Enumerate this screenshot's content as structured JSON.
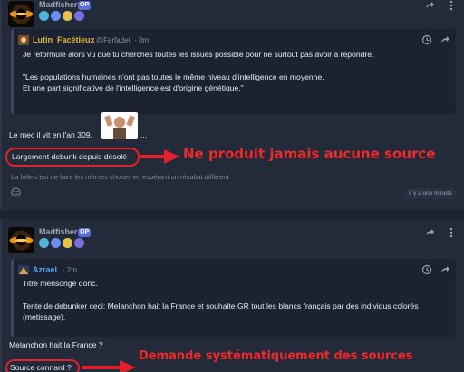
{
  "posts": [
    {
      "author": "Madfisher",
      "op_badge": "OP",
      "badges": [
        "#4fb5d9",
        "#6a8df2",
        "#e5c24a",
        "#7b6fe0"
      ],
      "quote": {
        "author": "Lutin_Facétieux",
        "handle": "@Farfadet",
        "time": "· 3m",
        "lines": [
          "Je reformule alors vu que tu cherches toutes les issues possible pour ne surtout pas avoir à répondre.",
          "\"Les populations humaines n'ont pas toutes le même niveau d'intelligence en moyenne.",
          "Et une part significative de l'intelligence est d'origine génétique.\""
        ]
      },
      "body": {
        "line1": "Le mec il vit en l'an 309.",
        "line1_suffix": "...",
        "highlighted": "Largement debunk depuis désolé",
        "signature": "La folie c'est de faire les mêmes choses en espérant un résultat différent"
      },
      "annotation": "Ne produit jamais aucune source",
      "time_chip": "Il y a une minute"
    },
    {
      "author": "Madfisher",
      "op_badge": "OP",
      "badges": [
        "#4fb5d9",
        "#6a8df2",
        "#e5c24a",
        "#7b6fe0"
      ],
      "quote": {
        "author": "Azrael",
        "time": "· 2m",
        "lines": [
          "Titre mensongé donc.",
          "Tente de debunker ceci: Melanchon hait la France et souhaite GR tout les blancs français par des individus colorés",
          "(metissage)."
        ]
      },
      "body": {
        "line1": "Melanchon hait la France ?",
        "highlighted": "Source connard ?"
      },
      "annotation": "Demande systématiquement des sources"
    }
  ],
  "colors": {
    "annotation_red": "#ee2a2a",
    "quote_author_1": "#e0b530",
    "quote_author_2": "#58a8e8",
    "op_badge": "#5a6de0"
  },
  "icons": [
    "history-icon",
    "share-icon",
    "smiley-icon"
  ]
}
